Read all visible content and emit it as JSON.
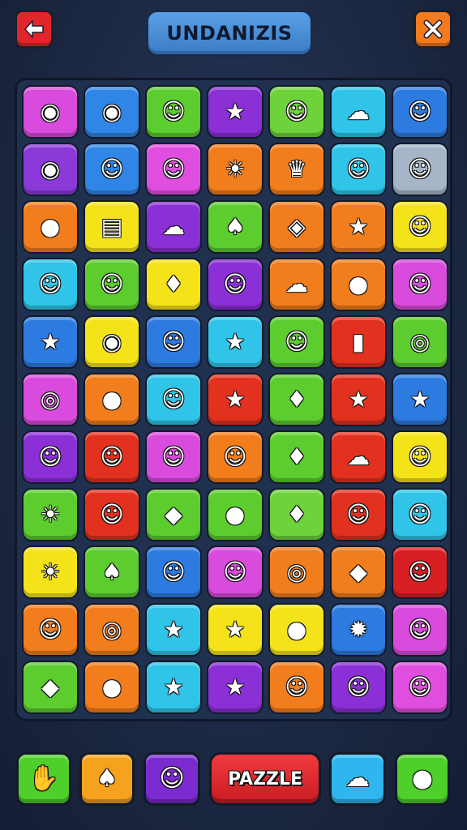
{
  "header": {
    "title": "UNDANIZIS",
    "back_icon": "arrow-left-icon",
    "close_icon": "close-x-icon"
  },
  "board": {
    "rows": [
      [
        {
          "color": "#d94bdc",
          "icon": "blob-face-icon",
          "glyph": "◉"
        },
        {
          "color": "#2f86e6",
          "icon": "turtle-face-icon",
          "glyph": "◉"
        },
        {
          "color": "#5ccc2e",
          "icon": "frog-face-icon",
          "glyph": "☺"
        },
        {
          "color": "#8b2fd6",
          "icon": "star-icon",
          "glyph": "★"
        },
        {
          "color": "#6ed23a",
          "icon": "cat-face-icon",
          "glyph": "☺"
        },
        {
          "color": "#2fc4e8",
          "icon": "cloud-face-icon",
          "glyph": "☁"
        },
        {
          "color": "#2d7be0",
          "icon": "crab-face-icon",
          "glyph": "☺"
        }
      ],
      [
        {
          "color": "#8b3ad8",
          "icon": "fish-icon",
          "glyph": "◉"
        },
        {
          "color": "#2f86e6",
          "icon": "bird-face-icon",
          "glyph": "☺"
        },
        {
          "color": "#e04ee0",
          "icon": "drop-face-icon",
          "glyph": "☺"
        },
        {
          "color": "#f27d1c",
          "icon": "sun-face-icon",
          "glyph": "☀"
        },
        {
          "color": "#f27d1c",
          "icon": "crown-face-icon",
          "glyph": "♛"
        },
        {
          "color": "#2fc4e8",
          "icon": "gear-face-icon",
          "glyph": "☺"
        },
        {
          "color": "#a6b6c8",
          "icon": "pig-face-icon",
          "glyph": "☺"
        }
      ],
      [
        {
          "color": "#f27d1c",
          "icon": "planet-icon",
          "glyph": "●"
        },
        {
          "color": "#f5e31a",
          "icon": "flag-icon",
          "glyph": "▤"
        },
        {
          "color": "#8b2fd6",
          "icon": "cloud-icon",
          "glyph": "☁"
        },
        {
          "color": "#5ccc2e",
          "icon": "carrot-icon",
          "glyph": "♠"
        },
        {
          "color": "#f27d1c",
          "icon": "gem-icon",
          "glyph": "◈"
        },
        {
          "color": "#f27d1c",
          "icon": "star-icon",
          "glyph": "★"
        },
        {
          "color": "#f5e31a",
          "icon": "blob-face-icon",
          "glyph": "☺"
        }
      ],
      [
        {
          "color": "#2fc4e8",
          "icon": "smile-face-icon",
          "glyph": "☺"
        },
        {
          "color": "#5ccc2e",
          "icon": "apple-face-icon",
          "glyph": "☺"
        },
        {
          "color": "#f5e31a",
          "icon": "candy-icon",
          "glyph": "♦"
        },
        {
          "color": "#8b2fd6",
          "icon": "frog-face-icon",
          "glyph": "☺"
        },
        {
          "color": "#f27d1c",
          "icon": "ghost-icon",
          "glyph": "☁"
        },
        {
          "color": "#f27d1c",
          "icon": "lemon-icon",
          "glyph": "●"
        },
        {
          "color": "#d94bdc",
          "icon": "blob-face-icon",
          "glyph": "☺"
        }
      ],
      [
        {
          "color": "#2d7be0",
          "icon": "star-icon",
          "glyph": "★"
        },
        {
          "color": "#f5e31a",
          "icon": "fish-icon",
          "glyph": "◉"
        },
        {
          "color": "#2d7be0",
          "icon": "smile-face-icon",
          "glyph": "☺"
        },
        {
          "color": "#2fc4e8",
          "icon": "star-icon",
          "glyph": "★"
        },
        {
          "color": "#5ccc2e",
          "icon": "plum-face-icon",
          "glyph": "☺"
        },
        {
          "color": "#e2311f",
          "icon": "bottle-icon",
          "glyph": "▮"
        },
        {
          "color": "#5ccc2e",
          "icon": "ring-icon",
          "glyph": "◎"
        }
      ],
      [
        {
          "color": "#d94bdc",
          "icon": "ring-icon",
          "glyph": "◎"
        },
        {
          "color": "#f27d1c",
          "icon": "egg-icon",
          "glyph": "●"
        },
        {
          "color": "#2fc4e8",
          "icon": "chick-face-icon",
          "glyph": "☺"
        },
        {
          "color": "#e2311f",
          "icon": "star-icon",
          "glyph": "★"
        },
        {
          "color": "#5ccc2e",
          "icon": "candy-icon",
          "glyph": "♦"
        },
        {
          "color": "#e2311f",
          "icon": "star-icon",
          "glyph": "★"
        },
        {
          "color": "#2d7be0",
          "icon": "star-face-icon",
          "glyph": "★"
        }
      ],
      [
        {
          "color": "#8b2fd6",
          "icon": "chick-face-icon",
          "glyph": "☺"
        },
        {
          "color": "#e2311f",
          "icon": "blob-face-icon",
          "glyph": "☺"
        },
        {
          "color": "#d94bdc",
          "icon": "drop-face-icon",
          "glyph": "☺"
        },
        {
          "color": "#f27d1c",
          "icon": "bird-face-icon",
          "glyph": "☺"
        },
        {
          "color": "#5ccc2e",
          "icon": "feather-icon",
          "glyph": "♦"
        },
        {
          "color": "#e2311f",
          "icon": "cloud-icon",
          "glyph": "☁"
        },
        {
          "color": "#f5e31a",
          "icon": "crab-face-icon",
          "glyph": "☺"
        }
      ],
      [
        {
          "color": "#5ccc2e",
          "icon": "sun-face-icon",
          "glyph": "☀"
        },
        {
          "color": "#e2311f",
          "icon": "cat-face-icon",
          "glyph": "☺"
        },
        {
          "color": "#5ccc2e",
          "icon": "fish-icon",
          "glyph": "◆"
        },
        {
          "color": "#5ccc2e",
          "icon": "ice-cream-icon",
          "glyph": "●"
        },
        {
          "color": "#6ed23a",
          "icon": "shell-icon",
          "glyph": "♦"
        },
        {
          "color": "#e2311f",
          "icon": "blob-face-icon",
          "glyph": "☺"
        },
        {
          "color": "#2fc4e8",
          "icon": "slime-face-icon",
          "glyph": "☺"
        }
      ],
      [
        {
          "color": "#f5e31a",
          "icon": "sun-face-icon",
          "glyph": "☀"
        },
        {
          "color": "#5ccc2e",
          "icon": "leaf-icon",
          "glyph": "♠"
        },
        {
          "color": "#2d7be0",
          "icon": "turtle-face-icon",
          "glyph": "☺"
        },
        {
          "color": "#d94bdc",
          "icon": "ghost-icon",
          "glyph": "☺"
        },
        {
          "color": "#f27d1c",
          "icon": "candy-icon",
          "glyph": "◎"
        },
        {
          "color": "#f27d1c",
          "icon": "fish-icon",
          "glyph": "◆"
        },
        {
          "color": "#d61f23",
          "icon": "chick-face-icon",
          "glyph": "☺"
        }
      ],
      [
        {
          "color": "#f27d1c",
          "icon": "blob-face-icon",
          "glyph": "☺"
        },
        {
          "color": "#f27d1c",
          "icon": "ring-icon",
          "glyph": "◎"
        },
        {
          "color": "#2fc4e8",
          "icon": "star-icon",
          "glyph": "★"
        },
        {
          "color": "#f5e31a",
          "icon": "star-face-icon",
          "glyph": "★"
        },
        {
          "color": "#f5e31a",
          "icon": "planet-icon",
          "glyph": "●"
        },
        {
          "color": "#2d7be0",
          "icon": "gear-face-icon",
          "glyph": "✹"
        },
        {
          "color": "#d94bdc",
          "icon": "chick-face-icon",
          "glyph": "☺"
        }
      ],
      [
        {
          "color": "#5ccc2e",
          "icon": "fish-icon",
          "glyph": "◆"
        },
        {
          "color": "#f27d1c",
          "icon": "candy-icon",
          "glyph": "●"
        },
        {
          "color": "#2fc4e8",
          "icon": "star-icon",
          "glyph": "★"
        },
        {
          "color": "#8b2fd6",
          "icon": "star-icon",
          "glyph": "★"
        },
        {
          "color": "#f27d1c",
          "icon": "smile-face-icon",
          "glyph": "☺"
        },
        {
          "color": "#8b2fd6",
          "icon": "blob-face-icon",
          "glyph": "☺"
        },
        {
          "color": "#e04ee0",
          "icon": "lemon-face-icon",
          "glyph": "☺"
        }
      ]
    ]
  },
  "footer": {
    "puzzle_label": "PAZZLE",
    "buttons": [
      {
        "color": "#4fcf2a",
        "icon": "hand-icon",
        "glyph": "✋"
      },
      {
        "color": "#f5a21e",
        "icon": "carrot-icon",
        "glyph": "♠"
      },
      {
        "color": "#7b2bd0",
        "icon": "chick-face-icon",
        "glyph": "☺"
      },
      {
        "color": "#2fb6ef",
        "icon": "cloud-icon",
        "glyph": "☁"
      },
      {
        "color": "#4fcf2a",
        "icon": "speech-bubble-icon",
        "glyph": "●"
      }
    ]
  }
}
